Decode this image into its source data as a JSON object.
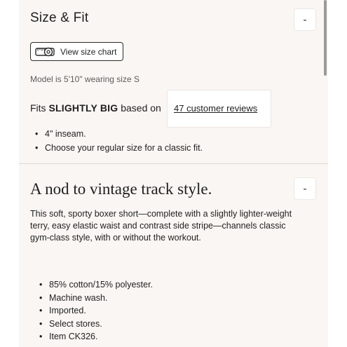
{
  "size_fit": {
    "title": "Size & Fit",
    "toggle_label": "-",
    "size_chart_label": "View size chart",
    "size_chart_icon": "measuring-tape-icon",
    "model_text": "Model is 5'10\" wearing size S",
    "fits_prefix": "Fits ",
    "fits_value": "SLIGHTLY BIG",
    "fits_suffix": " based on",
    "reviews_link": "47 customer reviews",
    "bullets": [
      "4\" inseam.",
      "Choose your regular size for a classic fit."
    ]
  },
  "details": {
    "heading": "A nod to vintage track style.",
    "toggle_label": "-",
    "description": "This soft, sporty boxer short—complete with a slightly lighter-weight terry, easy elastic waist and contrast side stripe—channels classic gym-class style, with or without the workout.",
    "bullets": [
      "85% cotton/15% polyester.",
      "Machine wash.",
      "Imported.",
      "Select stores.",
      "Item CK326."
    ]
  }
}
